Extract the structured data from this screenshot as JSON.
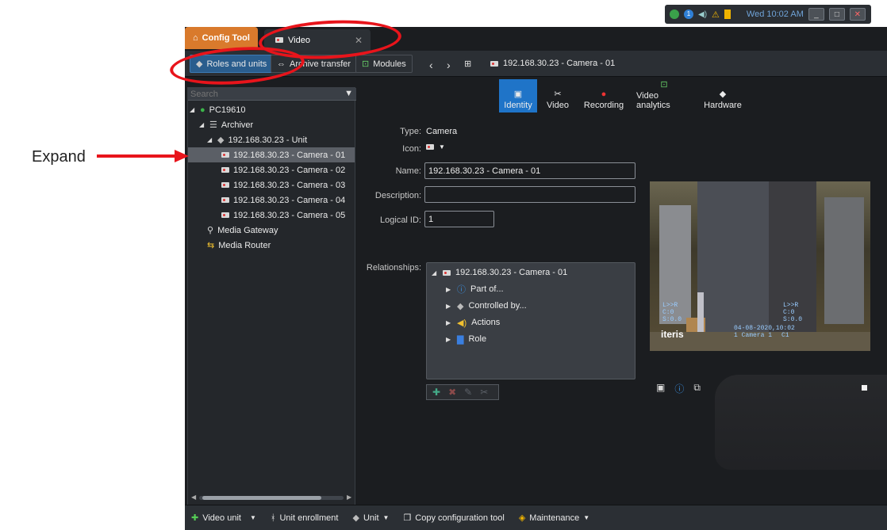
{
  "tray": {
    "clock": "Wed 10:02 AM",
    "badge": "1"
  },
  "tabs": {
    "config_tool": "Config Tool",
    "video": "Video"
  },
  "toolbar": {
    "roles_units": "Roles and units",
    "archive_transfer": "Archive transfer",
    "modules": "Modules",
    "breadcrumb": "192.168.30.23 - Camera - 01"
  },
  "left": {
    "search_placeholder": "Search",
    "tree": [
      {
        "label": "PC19610"
      },
      {
        "label": "Archiver"
      },
      {
        "label": "192.168.30.23 - Unit"
      },
      {
        "label": "192.168.30.23 - Camera - 01"
      },
      {
        "label": "192.168.30.23 - Camera - 02"
      },
      {
        "label": "192.168.30.23 - Camera - 03"
      },
      {
        "label": "192.168.30.23 - Camera - 04"
      },
      {
        "label": "192.168.30.23 - Camera - 05"
      },
      {
        "label": "Media Gateway"
      },
      {
        "label": "Media Router"
      }
    ]
  },
  "content_tabs": [
    "Identity",
    "Video",
    "Recording",
    "Video analytics",
    "Hardware"
  ],
  "form": {
    "type_label": "Type:",
    "type_value": "Camera",
    "icon_label": "Icon:",
    "name_label": "Name:",
    "name_value": "192.168.30.23 - Camera - 01",
    "description_label": "Description:",
    "description_value": "",
    "logical_id_label": "Logical ID:",
    "logical_id_value": "1",
    "relationships_label": "Relationships:",
    "relationships": {
      "root": "192.168.30.23 - Camera - 01",
      "children": [
        "Part of...",
        "Controlled by...",
        "Actions",
        "Role"
      ]
    }
  },
  "preview": {
    "overlay_left": "L>>R\nC:0\nS:0.0",
    "overlay_right": "L>>R\nC:0\nS:0.0",
    "timestamp": "04-08-2020,10:02",
    "camera_label": "1 Camera 1",
    "channel": "C1",
    "brand": "iteris"
  },
  "bottom": {
    "video_unit": "Video unit",
    "unit_enrollment": "Unit enrollment",
    "unit": "Unit",
    "copy_config": "Copy configuration tool",
    "maintenance": "Maintenance"
  },
  "annotation": {
    "expand": "Expand"
  },
  "colors": {
    "accent": "#1f74c8",
    "config_tab": "#d97a2c",
    "annotation": "#e8141b"
  }
}
